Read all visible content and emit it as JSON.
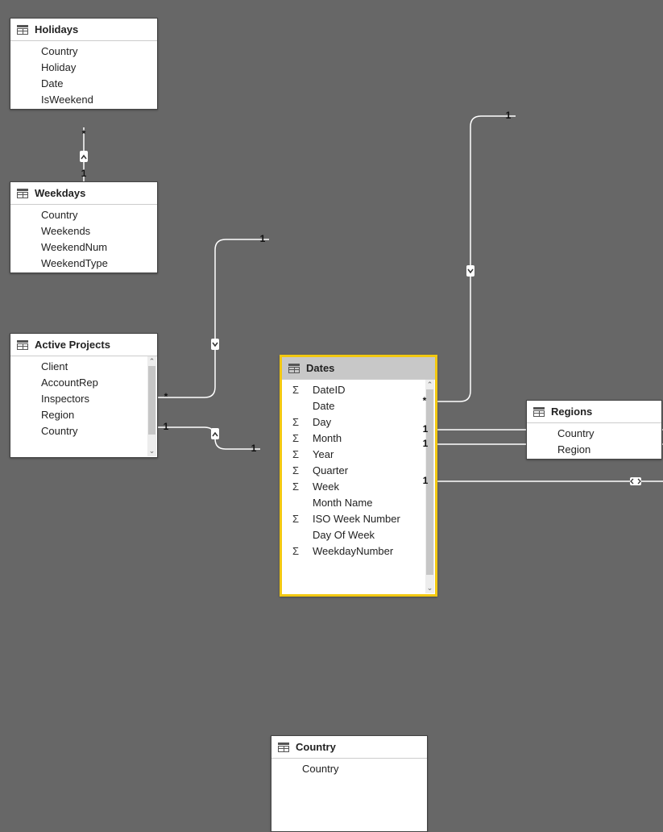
{
  "tables": {
    "holidays": {
      "title": "Holidays",
      "fields": [
        {
          "label": "Country",
          "icon": ""
        },
        {
          "label": "Holiday",
          "icon": ""
        },
        {
          "label": "Date",
          "icon": ""
        },
        {
          "label": "IsWeekend",
          "icon": ""
        }
      ]
    },
    "weekdays": {
      "title": "Weekdays",
      "fields": [
        {
          "label": "Country",
          "icon": ""
        },
        {
          "label": "Weekends",
          "icon": ""
        },
        {
          "label": "WeekendNum",
          "icon": ""
        },
        {
          "label": "WeekendType",
          "icon": ""
        }
      ]
    },
    "activeprojects": {
      "title": "Active Projects",
      "fields": [
        {
          "label": "Client",
          "icon": ""
        },
        {
          "label": "AccountRep",
          "icon": ""
        },
        {
          "label": "Inspectors",
          "icon": ""
        },
        {
          "label": "Region",
          "icon": ""
        },
        {
          "label": "Country",
          "icon": ""
        }
      ]
    },
    "dates": {
      "title": "Dates",
      "fields": [
        {
          "label": "DateID",
          "icon": "sigma"
        },
        {
          "label": "Date",
          "icon": ""
        },
        {
          "label": "Day",
          "icon": "sigma"
        },
        {
          "label": "Month",
          "icon": "sigma"
        },
        {
          "label": "Year",
          "icon": "sigma"
        },
        {
          "label": "Quarter",
          "icon": "sigma"
        },
        {
          "label": "Week",
          "icon": "sigma"
        },
        {
          "label": "Month Name",
          "icon": ""
        },
        {
          "label": "ISO Week Number",
          "icon": "sigma"
        },
        {
          "label": "Day Of Week",
          "icon": ""
        },
        {
          "label": "WeekdayNumber",
          "icon": "sigma"
        }
      ]
    },
    "regions": {
      "title": "Regions",
      "fields": [
        {
          "label": "Country",
          "icon": ""
        },
        {
          "label": "Region",
          "icon": ""
        }
      ]
    },
    "country": {
      "title": "Country",
      "fields": [
        {
          "label": "Country",
          "icon": ""
        }
      ]
    }
  },
  "relationships": [
    {
      "from": "holidays",
      "to": "weekdays",
      "from_card": "*",
      "to_card": "1",
      "direction": "to>from"
    },
    {
      "from": "dates",
      "to": "activeprojects",
      "from_card": "1",
      "to_card": "*",
      "direction": "from>to"
    },
    {
      "from": "regions",
      "to": "country",
      "from_card": "1",
      "to_card": "*",
      "direction": "from>to"
    },
    {
      "from": "country",
      "to": "activeprojects",
      "from_card": "1",
      "to_card": "*",
      "direction": "from>to"
    },
    {
      "from": "country",
      "to": "right-off1",
      "from_card": "1",
      "to_card": "",
      "direction": ""
    },
    {
      "from": "country",
      "to": "right-off2",
      "from_card": "1",
      "to_card": "",
      "direction": ""
    },
    {
      "from": "country",
      "to": "right-off3",
      "from_card": "1",
      "to_card": "",
      "direction": "both"
    }
  ],
  "labels": {
    "holidays_bottom": "*",
    "weekdays_top": "1",
    "dates_left": "1",
    "active_right": "*",
    "regions_bottom": "1",
    "country_top_right": "*",
    "country_right_1": "1",
    "country_right_2": "1",
    "country_right_3": "1",
    "country_left": "1",
    "active_bottom": "1"
  }
}
